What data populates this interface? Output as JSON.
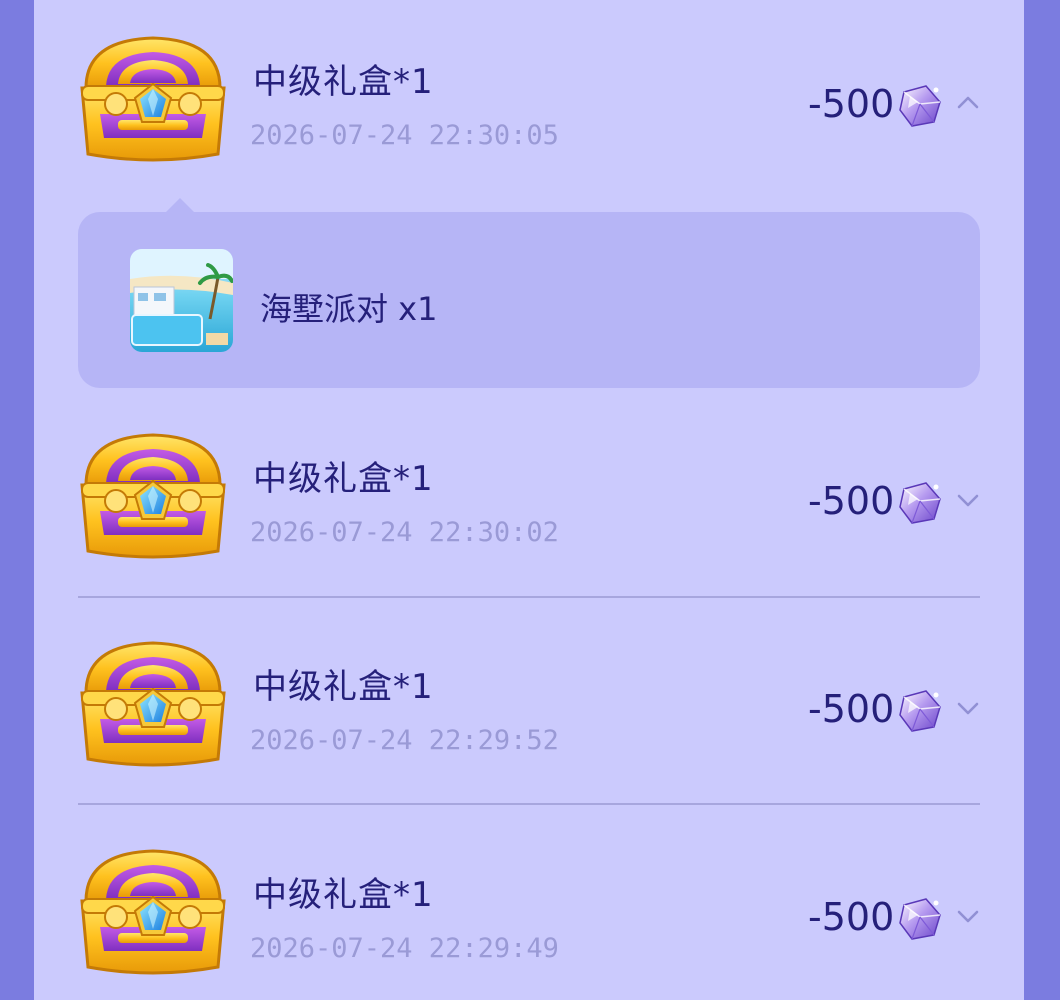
{
  "expanded_detail": {
    "item_label": "海墅派对 x1",
    "thumbnail_icon": "beach-villa-image"
  },
  "records": [
    {
      "title": "中级礼盒*1",
      "time": "2026-07-24 22:30:05",
      "amount": "-500",
      "expanded": true,
      "chevron_icon": "chevron-up-icon"
    },
    {
      "title": "中级礼盒*1",
      "time": "2026-07-24 22:30:02",
      "amount": "-500",
      "expanded": false,
      "chevron_icon": "chevron-down-icon"
    },
    {
      "title": "中级礼盒*1",
      "time": "2026-07-24 22:29:52",
      "amount": "-500",
      "expanded": false,
      "chevron_icon": "chevron-down-icon"
    },
    {
      "title": "中级礼盒*1",
      "time": "2026-07-24 22:29:49",
      "amount": "-500",
      "expanded": false,
      "chevron_icon": "chevron-down-icon"
    }
  ],
  "colors": {
    "background": "#7b7ce0",
    "panel": "#cbcafd",
    "detail_panel": "#b6b5f6",
    "text_primary": "#25207a",
    "text_secondary": "#9a9ad6",
    "divider": "#a7a6de"
  }
}
